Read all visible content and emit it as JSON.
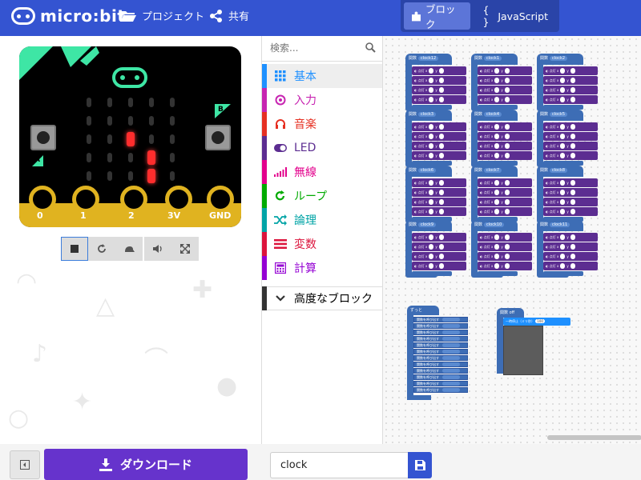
{
  "app": {
    "logo_text": "micro:bit"
  },
  "header": {
    "projects_label": "プロジェクト",
    "share_label": "共有",
    "blocks_tab": "ブロック",
    "js_tab_prefix": "{ }",
    "js_tab": "JavaScript"
  },
  "simulator": {
    "pins": [
      "0",
      "1",
      "2",
      "3V",
      "GND"
    ],
    "button_a": "A",
    "button_b": "B",
    "lit_leds": [
      [
        2,
        2
      ],
      [
        3,
        3
      ],
      [
        3,
        4
      ]
    ]
  },
  "toolbox": {
    "search_placeholder": "検索...",
    "categories": [
      {
        "label": "基本",
        "color": "#1e90ff",
        "icon": "grid-icon"
      },
      {
        "label": "入力",
        "color": "#c724b1",
        "icon": "target-icon"
      },
      {
        "label": "音楽",
        "color": "#e63022",
        "icon": "headphones-icon"
      },
      {
        "label": "LED",
        "color": "#5c2d91",
        "icon": "toggle-icon"
      },
      {
        "label": "無線",
        "color": "#e3008c",
        "icon": "signal-icon"
      },
      {
        "label": "ループ",
        "color": "#00aa00",
        "icon": "loop-icon"
      },
      {
        "label": "論理",
        "color": "#00a4a6",
        "icon": "shuffle-icon"
      },
      {
        "label": "変数",
        "color": "#dc143c",
        "icon": "lines-icon"
      },
      {
        "label": "計算",
        "color": "#9400d3",
        "icon": "calculator-icon"
      }
    ],
    "advanced_label": "高度なブロック"
  },
  "workspace": {
    "functions": [
      "clock12",
      "clock1",
      "clock2",
      "clock3",
      "clock4",
      "clock5",
      "clock6",
      "clock7",
      "clock8",
      "clock9",
      "clock10",
      "clock11"
    ],
    "forever_label": "ずっと",
    "off_function": "off",
    "pause_label": "一時停止（ミリ秒）",
    "pause_value": "100"
  },
  "footer": {
    "download_label": "ダウンロード",
    "project_name": "clock"
  }
}
